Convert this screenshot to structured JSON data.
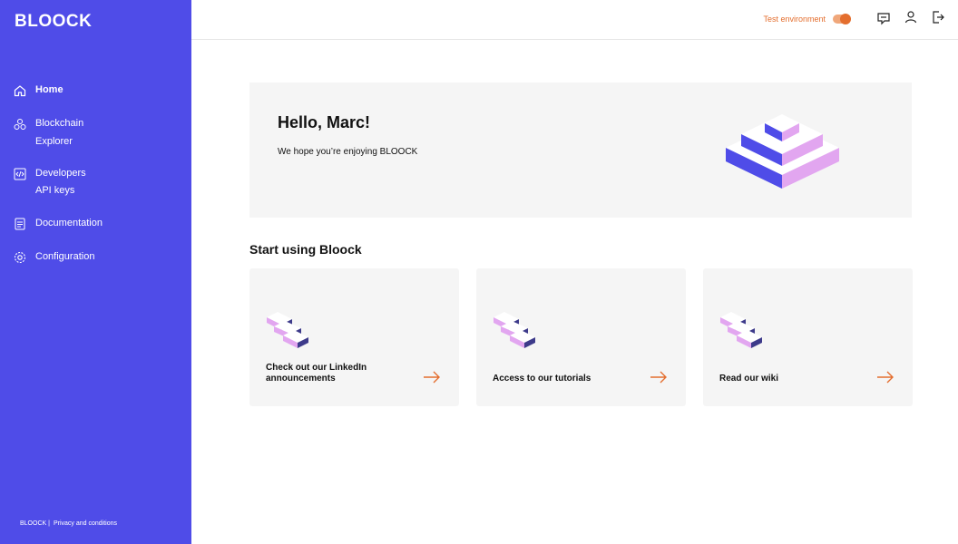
{
  "brand": {
    "logo": "BLOOCK",
    "accent": "#4f4ce8",
    "orange": "#e46e2e"
  },
  "sidebar": {
    "items": [
      {
        "label": "Home",
        "icon": "home-icon"
      },
      {
        "label": "Blockchain",
        "label2": "Explorer",
        "icon": "blocks-icon"
      },
      {
        "label": "Developers",
        "icon": "code-icon",
        "sub": "API keys"
      },
      {
        "label": "Documentation",
        "icon": "document-icon"
      },
      {
        "label": "Configuration",
        "icon": "gear-icon"
      }
    ],
    "footer": {
      "brand": "BLOOCK |",
      "privacy": "Privacy and conditions"
    }
  },
  "topbar": {
    "env_label": "Test environment",
    "toggle_on": true,
    "icons": [
      "chat-icon",
      "user-icon",
      "logout-icon"
    ]
  },
  "hero": {
    "title": "Hello, Marc!",
    "subtitle": "We hope you’re enjoying BLOOCK"
  },
  "section": {
    "title": "Start using Bloock"
  },
  "cards": [
    {
      "line1": "Check out our LinkedIn",
      "line2": "announcements"
    },
    {
      "line1": "Access to our tutorials"
    },
    {
      "line1": "Read our wiki"
    }
  ]
}
